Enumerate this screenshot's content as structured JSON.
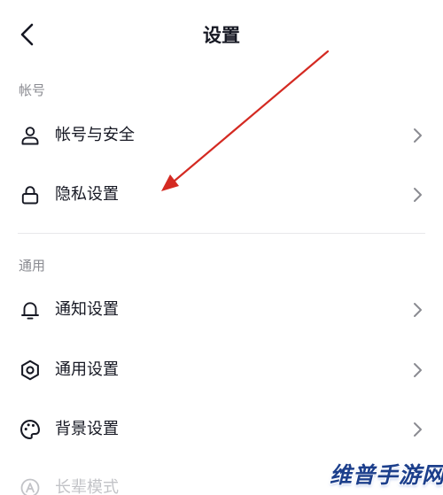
{
  "header": {
    "title": "设置"
  },
  "sections": [
    {
      "label": "帐号",
      "items": [
        {
          "label": "帐号与安全",
          "icon": "user-icon"
        },
        {
          "label": "隐私设置",
          "icon": "lock-icon"
        }
      ]
    },
    {
      "label": "通用",
      "items": [
        {
          "label": "通知设置",
          "icon": "bell-icon"
        },
        {
          "label": "通用设置",
          "icon": "gear-icon"
        },
        {
          "label": "背景设置",
          "icon": "palette-icon"
        },
        {
          "label": "长辈模式",
          "icon": "elder-mode-icon"
        }
      ]
    }
  ],
  "watermark": "维普手游网",
  "colors": {
    "text": "#161823",
    "section_label": "#8a8b91",
    "chevron": "#8a8b91",
    "divider": "#e8e8ea",
    "annotation_arrow": "#d42a22",
    "watermark": "#1c3f8c"
  }
}
